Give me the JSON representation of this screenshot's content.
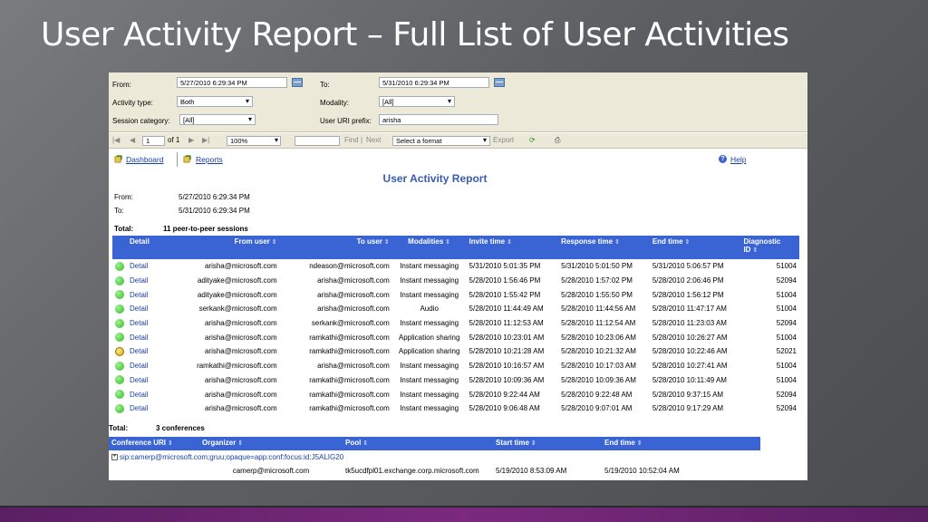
{
  "slide": {
    "title": "User Activity Report – Full List of User Activities"
  },
  "params": {
    "from_label": "From:",
    "from_value": "5/27/2010 6:29:34 PM",
    "to_label": "To:",
    "to_value": "5/31/2010 6:29:34 PM",
    "activity_type_label": "Activity type:",
    "activity_type_value": "Both",
    "modality_label": "Modality:",
    "modality_value": "[All]",
    "session_category_label": "Session category:",
    "session_category_value": "[All]",
    "user_uri_label": "User URI prefix:",
    "user_uri_value": "arisha"
  },
  "toolbar": {
    "page_value": "1",
    "page_of": "of 1",
    "zoom": "100%",
    "find_label": "Find",
    "divider": "|",
    "next_label": "Next",
    "format_select": "Select a format",
    "export_label": "Export"
  },
  "nav": {
    "dashboard": "Dashboard",
    "reports": "Reports",
    "help": "Help"
  },
  "report": {
    "title": "User Activity Report",
    "from_label": "From:",
    "from_value": "5/27/2010 6:29:34 PM",
    "to_label": "To:",
    "to_value": "5/31/2010 6:29:34 PM",
    "total_label": "Total:",
    "total_value": "11 peer-to-peer sessions"
  },
  "sessions": {
    "headers": [
      "Detail",
      "From user",
      "To user",
      "Modalities",
      "Invite time",
      "Response time",
      "End time",
      "Diagnostic ID"
    ],
    "rows": [
      {
        "status": "green",
        "detail": "Detail",
        "from": "arisha@microsoft.com",
        "to": "ndeason@microsoft.com",
        "modality": "Instant messaging",
        "invite": "5/31/2010 5:01:35 PM",
        "response": "5/31/2010 5:01:50 PM",
        "end": "5/31/2010 5:06:57 PM",
        "diag": "51004"
      },
      {
        "status": "green",
        "detail": "Detail",
        "from": "adityake@microsoft.com",
        "to": "arisha@microsoft.com",
        "modality": "Instant messaging",
        "invite": "5/28/2010 1:56:46 PM",
        "response": "5/28/2010 1:57:02 PM",
        "end": "5/28/2010 2:06:46 PM",
        "diag": "52094"
      },
      {
        "status": "green",
        "detail": "Detail",
        "from": "adityake@microsoft.com",
        "to": "arisha@microsoft.com",
        "modality": "Instant messaging",
        "invite": "5/28/2010 1:55:42 PM",
        "response": "5/28/2010 1:55:50 PM",
        "end": "5/28/2010 1:56:12 PM",
        "diag": "51004"
      },
      {
        "status": "green",
        "detail": "Detail",
        "from": "serkank@microsoft.com",
        "to": "arisha@microsoft.com",
        "modality": "Audio",
        "invite": "5/28/2010 11:44:49 AM",
        "response": "5/28/2010 11:44:56 AM",
        "end": "5/28/2010 11:47:17 AM",
        "diag": "51004"
      },
      {
        "status": "green",
        "detail": "Detail",
        "from": "arisha@microsoft.com",
        "to": "serkank@microsoft.com",
        "modality": "Instant messaging",
        "invite": "5/28/2010 11:12:53 AM",
        "response": "5/28/2010 11:12:54 AM",
        "end": "5/28/2010 11:23:03 AM",
        "diag": "52094"
      },
      {
        "status": "green",
        "detail": "Detail",
        "from": "arisha@microsoft.com",
        "to": "ramkathi@microsoft.com",
        "modality": "Application sharing",
        "invite": "5/28/2010 10:23:01 AM",
        "response": "5/28/2010 10:23:06 AM",
        "end": "5/28/2010 10:26:27 AM",
        "diag": "51004"
      },
      {
        "status": "yellow",
        "detail": "Detail",
        "from": "arisha@microsoft.com",
        "to": "ramkathi@microsoft.com",
        "modality": "Application sharing",
        "invite": "5/28/2010 10:21:28 AM",
        "response": "5/28/2010 10:21:32 AM",
        "end": "5/28/2010 10:22:46 AM",
        "diag": "52021"
      },
      {
        "status": "green",
        "detail": "Detail",
        "from": "ramkathi@microsoft.com",
        "to": "arisha@microsoft.com",
        "modality": "Instant messaging",
        "invite": "5/28/2010 10:16:57 AM",
        "response": "5/28/2010 10:17:03 AM",
        "end": "5/28/2010 10:27:41 AM",
        "diag": "51004"
      },
      {
        "status": "green",
        "detail": "Detail",
        "from": "arisha@microsoft.com",
        "to": "ramkathi@microsoft.com",
        "modality": "Instant messaging",
        "invite": "5/28/2010 10:09:36 AM",
        "response": "5/28/2010 10:09:36 AM",
        "end": "5/28/2010 10:11:49 AM",
        "diag": "51004"
      },
      {
        "status": "green",
        "detail": "Detail",
        "from": "arisha@microsoft.com",
        "to": "ramkathi@microsoft.com",
        "modality": "Instant messaging",
        "invite": "5/28/2010 9:22:44 AM",
        "response": "5/28/2010 9:22:48 AM",
        "end": "5/28/2010 9:37:15 AM",
        "diag": "52094"
      },
      {
        "status": "green",
        "detail": "Detail",
        "from": "arisha@microsoft.com",
        "to": "ramkathi@microsoft.com",
        "modality": "Instant messaging",
        "invite": "5/28/2010 9:06:48 AM",
        "response": "5/28/2010 9:07:01 AM",
        "end": "5/28/2010 9:17:29 AM",
        "diag": "52094"
      }
    ]
  },
  "conferences": {
    "total_label": "Total:",
    "total_value": "3 conferences",
    "headers": [
      "Conference URI",
      "Organizer",
      "Pool",
      "Start time",
      "End time"
    ],
    "uri": "sip:camerp@microsoft.com;gruu;opaque=app:conf:focus:id:J5ALIG20",
    "organizer": "camerp@microsoft.com",
    "pool": "tk5ucdfpl01.exchange.corp.microsoft.com",
    "start": "5/19/2010 8:53:09 AM",
    "end": "5/19/2010 10:52:04 AM"
  },
  "colors": {
    "header_blue": "#3a63d4",
    "link_blue": "#1a3fa8",
    "title_blue": "#3b5bb0",
    "status_green": "#2fb52a",
    "status_yellow": "#d9a800"
  }
}
